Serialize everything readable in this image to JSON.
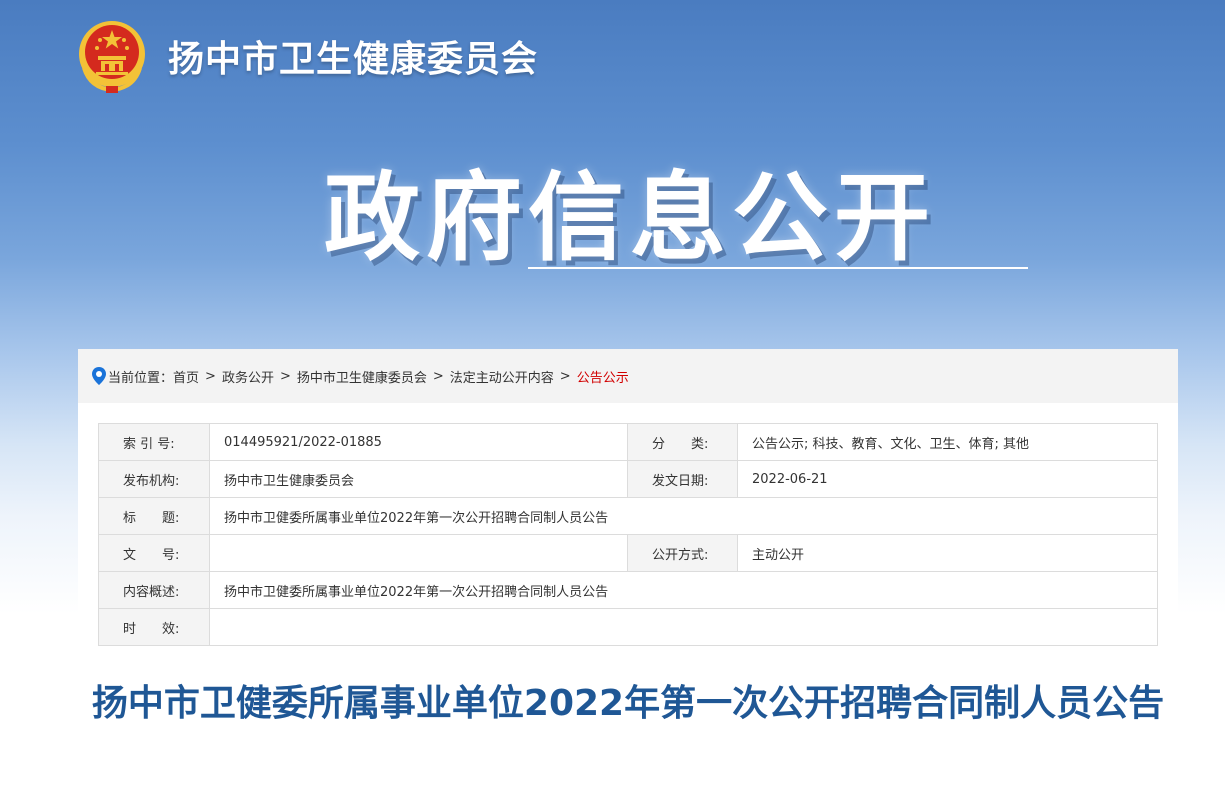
{
  "header": {
    "site_title": "扬中市卫生健康委员会",
    "banner_title": "政府信息公开"
  },
  "breadcrumb": {
    "prefix": "当前位置：",
    "items": [
      "首页",
      "政务公开",
      "扬中市卫生健康委员会",
      "法定主动公开内容"
    ],
    "current": "公告公示",
    "separator": ">"
  },
  "meta": {
    "index_label": "索 引 号:",
    "index_value": "014495921/2022-01885",
    "category_label": "分　　类:",
    "category_value": "公告公示;  科技、教育、文化、卫生、体育;  其他",
    "publisher_label": "发布机构:",
    "publisher_value": "扬中市卫生健康委员会",
    "date_label": "发文日期:",
    "date_value": "2022-06-21",
    "title_label": "标　　题:",
    "title_value": "扬中市卫健委所属事业单位2022年第一次公开招聘合同制人员公告",
    "docno_label": "文　　号:",
    "docno_value": "",
    "mode_label": "公开方式:",
    "mode_value": "主动公开",
    "summary_label": "内容概述:",
    "summary_value": "扬中市卫健委所属事业单位2022年第一次公开招聘合同制人员公告",
    "validity_label": "时　　效:",
    "validity_value": ""
  },
  "article": {
    "title": "扬中市卫健委所属事业单位2022年第一次公开招聘合同制人员公告"
  },
  "colors": {
    "title_blue": "#1f5795",
    "breadcrumb_current": "#d10000",
    "emblem_red": "#d42a1e",
    "emblem_gold": "#f3c237"
  }
}
